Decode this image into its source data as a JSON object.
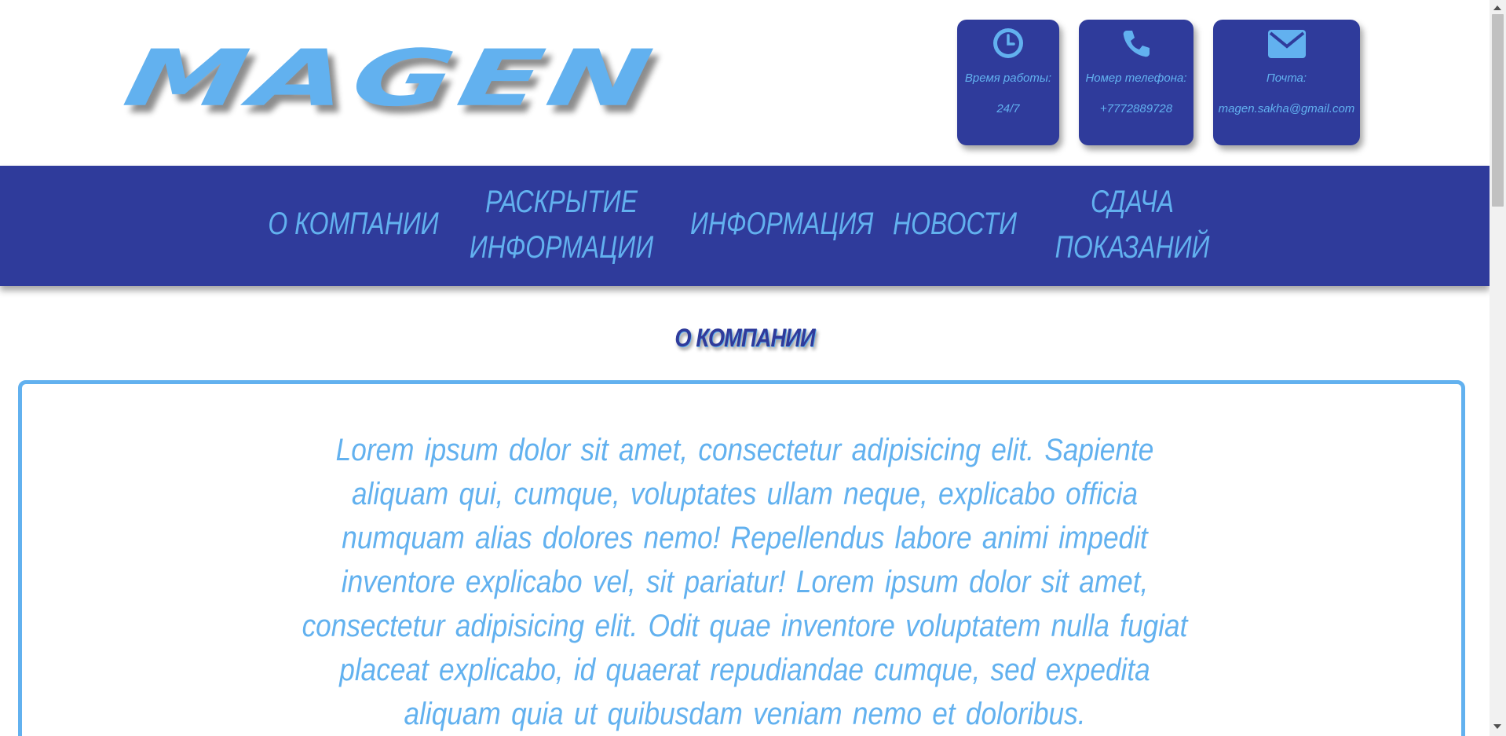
{
  "header": {
    "logo_text": "MAGEN",
    "cards": [
      {
        "icon": "clock-icon",
        "label": "Время работы:",
        "value": "24/7"
      },
      {
        "icon": "phone-icon",
        "label": "Номер телефона:",
        "value": "+7772889728"
      },
      {
        "icon": "envelope-icon",
        "label": "Почта:",
        "value": "magen.sakha@gmail.com"
      }
    ]
  },
  "nav": {
    "items": [
      {
        "label": "О КОМПАНИИ"
      },
      {
        "label": "РАСКРЫТИЕ ИНФОРМАЦИИ"
      },
      {
        "label": "ИНФОРМАЦИЯ"
      },
      {
        "label": "НОВОСТИ"
      },
      {
        "label": "СДАЧА ПОКАЗАНИЙ"
      }
    ]
  },
  "main": {
    "section_title": "О КОМПАНИИ",
    "body_text": "Lorem ipsum dolor sit amet, consectetur adipisicing elit. Sapiente aliquam qui, cumque, voluptates ullam neque, explicabo officia numquam alias dolores nemo! Repellendus labore animi impedit inventore explicabo vel, sit pariatur! Lorem ipsum dolor sit amet, consectetur adipisicing elit. Odit quae inventore voluptatem nulla fugiat placeat explicabo, id quaerat repudiandae cumque, sed expedita aliquam quia ut quibusdam veniam nemo et doloribus."
  },
  "colors": {
    "primary_dark": "#2f3b9b",
    "accent_light": "#62b1ef",
    "background": "#ffffff"
  }
}
